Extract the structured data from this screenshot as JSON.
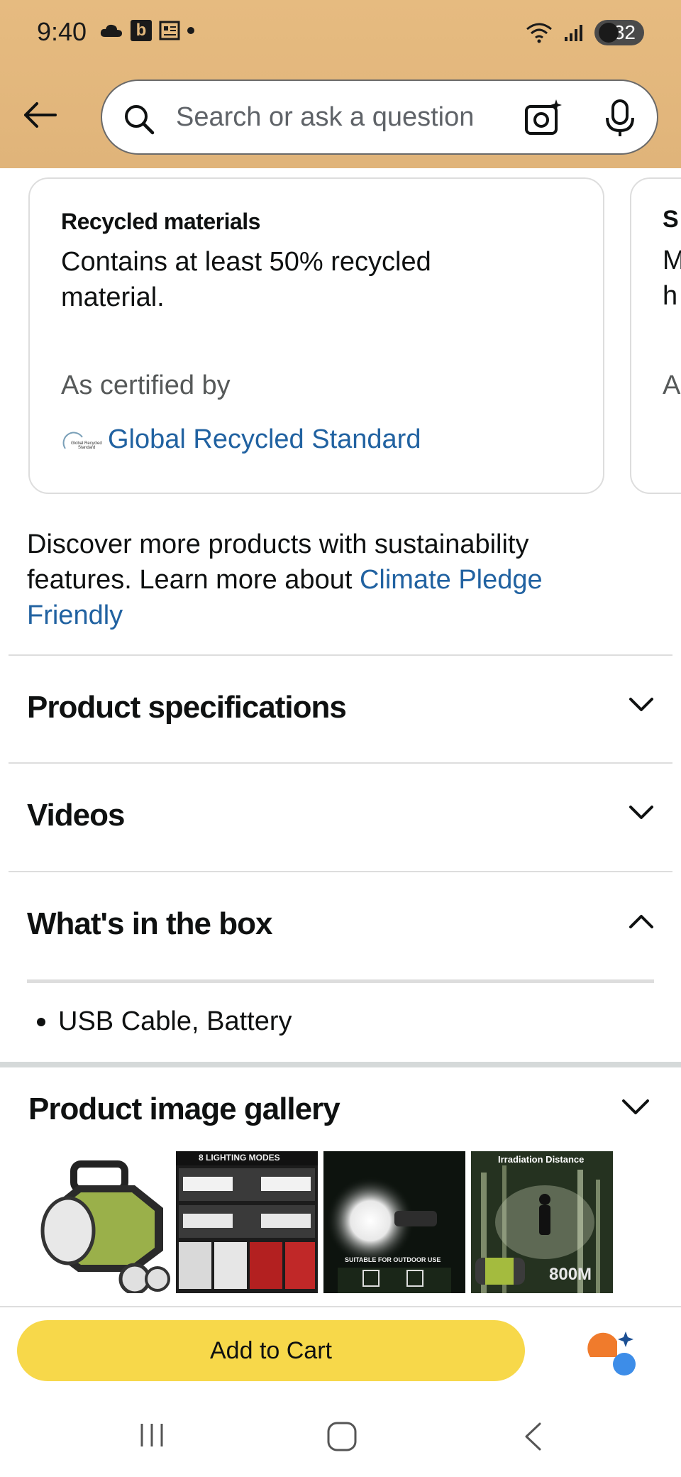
{
  "status_bar": {
    "time": "9:40",
    "badge_b": "b",
    "battery": "32"
  },
  "search": {
    "placeholder": "Search or ask a question"
  },
  "cert_card": {
    "title": "Recycled materials",
    "description": "Contains at least 50% recycled material.",
    "certified_by_label": "As certified by",
    "certifier": "Global Recycled Standard"
  },
  "peek_card": {
    "t1": "S",
    "t2": "M",
    "t3": "h",
    "t4": "A"
  },
  "discover": {
    "text": "Discover more products with sustainability features. Learn more about ",
    "link": "Climate Pledge Friendly"
  },
  "sections": {
    "specs": "Product specifications",
    "videos": "Videos",
    "in_box": "What's in the box"
  },
  "in_box_items": [
    "USB Cable, Battery"
  ],
  "gallery": {
    "title": "Product image gallery",
    "thumb2_caption": "8 LIGHTING MODES",
    "thumb3_caption": "SUITABLE FOR OUTDOOR USE",
    "thumb4_caption": "Irradiation Distance",
    "thumb4_value": "800M"
  },
  "cart": {
    "label": "Add to Cart"
  },
  "colors": {
    "header_bg": "#e2b87c",
    "link": "#2162a1",
    "cart_button": "#f7d84a"
  }
}
